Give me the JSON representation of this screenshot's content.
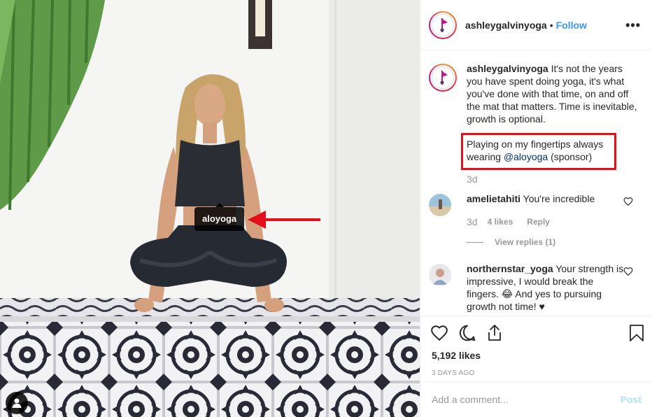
{
  "photo": {
    "product_tag": "aloyoga"
  },
  "header": {
    "username": "ashleygalvinyoga",
    "separator": "•",
    "follow_label": "Follow",
    "more_label": "•••"
  },
  "caption": {
    "username": "ashleygalvinyoga",
    "text": "It's not the years you have spent doing yoga, it's what you've done with that time, on and off the mat that matters. Time is inevitable, growth is optional.",
    "second_line_before": "Playing on my fingertips always wearing ",
    "mention": "@aloyoga",
    "second_line_after": " (sponsor)",
    "time": "3d"
  },
  "comments": [
    {
      "username": "amelietahiti",
      "text": "You're incredible",
      "time": "3d",
      "likes": "4 likes",
      "reply_label": "Reply",
      "view_replies": "View replies (1)"
    },
    {
      "username": "northernstar_yoga",
      "text": "Your strength is impressive, I would break the fingers. 😂 And yes to pursuing growth not time! ♥"
    }
  ],
  "footer": {
    "likes": "5,192 likes",
    "time_ago": "3 DAYS AGO",
    "comment_placeholder": "Add a comment...",
    "post_label": "Post"
  },
  "colors": {
    "accent": "#3897f0",
    "highlight": "#e3101a",
    "muted": "#999999"
  }
}
